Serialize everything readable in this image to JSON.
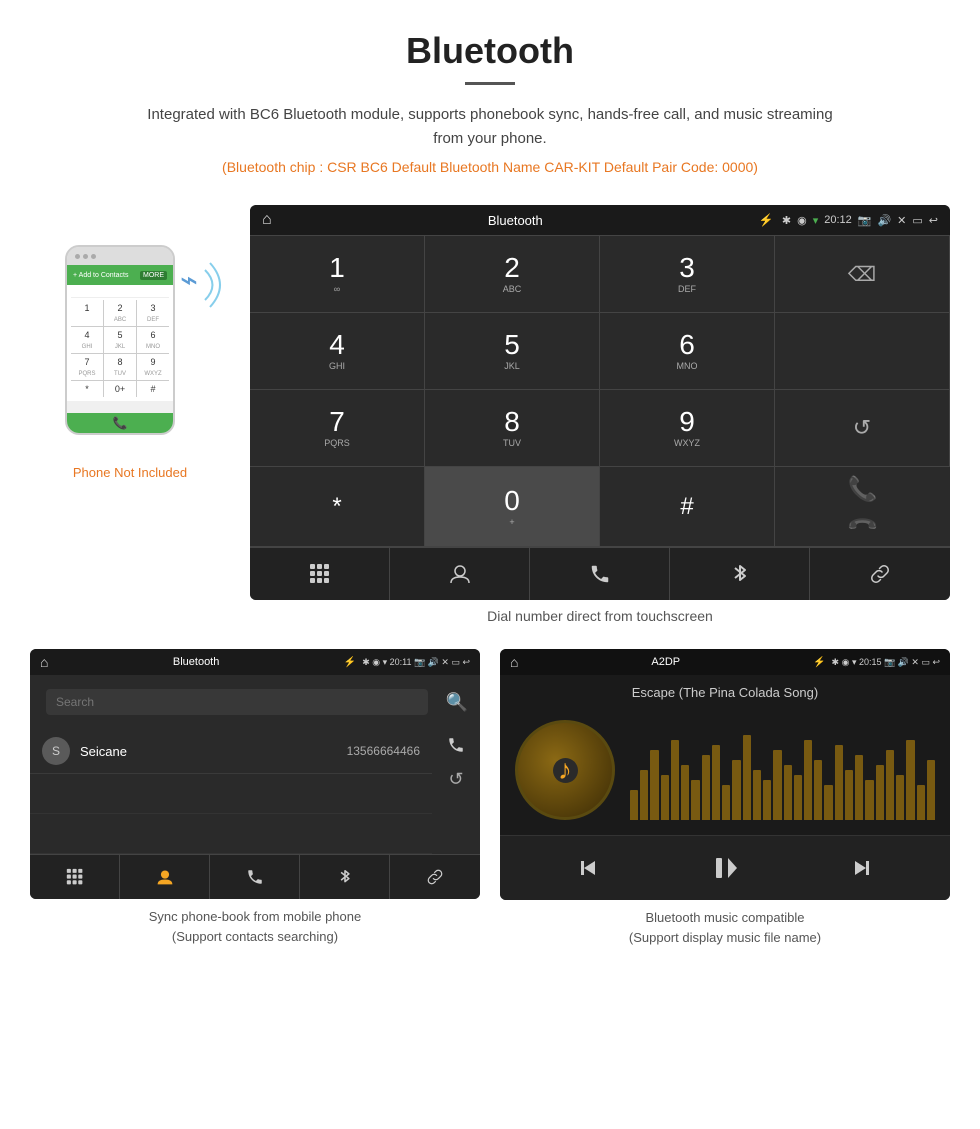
{
  "header": {
    "title": "Bluetooth",
    "description": "Integrated with BC6 Bluetooth module, supports phonebook sync, hands-free call, and music streaming from your phone.",
    "specs": "(Bluetooth chip : CSR BC6    Default Bluetooth Name CAR-KIT    Default Pair Code: 0000)"
  },
  "phone_label": "Phone Not Included",
  "dial_screen": {
    "statusbar": {
      "home_icon": "⌂",
      "title": "Bluetooth",
      "usb_icon": "⚡",
      "time": "20:12",
      "icons": "✱ ◉ ▾ 📷 🔊 ✕ ▭ ↩"
    },
    "keys": [
      {
        "num": "1",
        "letters": "∞"
      },
      {
        "num": "2",
        "letters": "ABC"
      },
      {
        "num": "3",
        "letters": "DEF"
      },
      {
        "num": "",
        "letters": ""
      },
      {
        "num": "4",
        "letters": "GHI"
      },
      {
        "num": "5",
        "letters": "JKL"
      },
      {
        "num": "6",
        "letters": "MNO"
      },
      {
        "num": "",
        "letters": ""
      },
      {
        "num": "7",
        "letters": "PQRS"
      },
      {
        "num": "8",
        "letters": "TUV"
      },
      {
        "num": "9",
        "letters": "WXYZ"
      },
      {
        "num": "",
        "letters": ""
      },
      {
        "num": "*",
        "letters": ""
      },
      {
        "num": "0",
        "letters": "+"
      },
      {
        "num": "#",
        "letters": ""
      },
      {
        "num": "",
        "letters": ""
      }
    ],
    "bottom_icons": [
      "⊞",
      "👤",
      "📞",
      "✱",
      "🔗"
    ],
    "caption": "Dial number direct from touchscreen"
  },
  "phonebook_screen": {
    "statusbar": {
      "home_icon": "⌂",
      "title": "Bluetooth",
      "usb_icon": "⚡",
      "time": "20:11"
    },
    "search_placeholder": "Search",
    "contacts": [
      {
        "initial": "S",
        "name": "Seicane",
        "number": "13566664466"
      }
    ],
    "bottom_icons": [
      "⊞",
      "👤",
      "📞",
      "✱",
      "🔗"
    ],
    "caption": "Sync phone-book from mobile phone\n(Support contacts searching)"
  },
  "music_screen": {
    "statusbar": {
      "home_icon": "⌂",
      "title": "A2DP",
      "usb_icon": "⚡",
      "time": "20:15"
    },
    "track_title": "Escape (The Pina Colada Song)",
    "controls": [
      "⏮",
      "⏯",
      "⏭"
    ],
    "caption": "Bluetooth music compatible\n(Support display music file name)"
  }
}
